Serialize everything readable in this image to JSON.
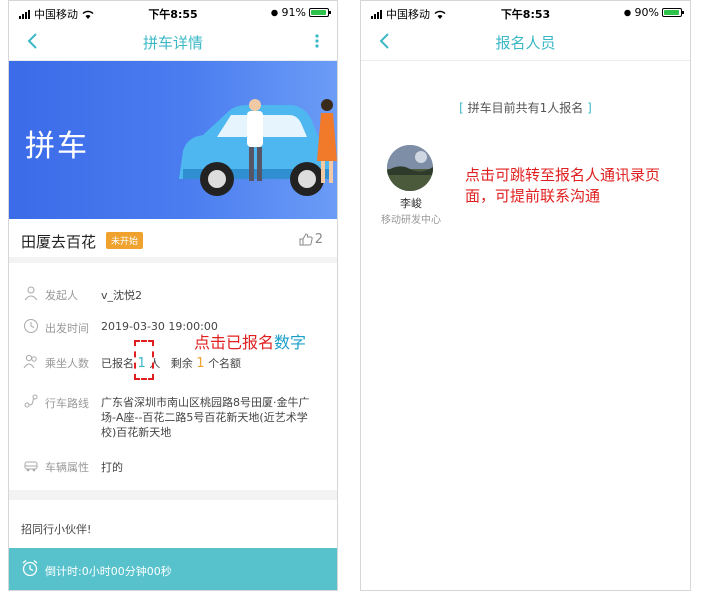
{
  "left": {
    "status": {
      "carrier": "中国移动",
      "time": "下午8:55",
      "battery": "91%"
    },
    "nav": {
      "title": "拼车详情"
    },
    "banner": {
      "text": "拼车"
    },
    "trip": {
      "title": "田厦去百花",
      "status_badge": "未开始",
      "likes": "2"
    },
    "info": {
      "initiator_label": "发起人",
      "initiator_value": "v_沈悦2",
      "depart_label": "出发时间",
      "depart_value": "2019-03-30 19:00:00",
      "passengers_label": "乘坐人数",
      "signed_prefix": "已报名",
      "signed_count": "1",
      "signed_unit": "人",
      "remaining_prefix": "剩余",
      "remaining_count": "1",
      "remaining_suffix": "个名额",
      "route_label": "行车路线",
      "route_value": "广东省深圳市南山区桃园路8号田厦·金牛广场-A座--百花二路5号百花新天地(近艺术学校)百花新天地",
      "vehicle_label": "车辆属性",
      "vehicle_value": "打的"
    },
    "invite": "招同行小伙伴!",
    "countdown": "倒计时:0小时00分钟00秒",
    "annotation": {
      "main": "点击已报名",
      "highlight": "数字"
    }
  },
  "right": {
    "status": {
      "carrier": "中国移动",
      "time": "下午8:53",
      "battery": "90%"
    },
    "nav": {
      "title": "报名人员"
    },
    "count_text": "拼车目前共有1人报名",
    "count_bracket_open": "[",
    "count_bracket_close": "]",
    "person": {
      "name": "李峻",
      "dept": "移动研发中心"
    },
    "annotation": "点击可跳转至报名人通讯录页面，可提前联系沟通"
  },
  "colors": {
    "accent": "#3bb8c6",
    "badge": "#f0a22e",
    "annotation": "#e02020",
    "banner": "#4b7df0"
  },
  "icons": [
    "signal-icon",
    "wifi-icon",
    "alarm-icon",
    "battery-icon",
    "back-chevron-icon",
    "more-dots-icon",
    "thumbs-up-icon",
    "person-icon",
    "clock-icon",
    "group-icon",
    "route-icon",
    "car-icon",
    "alarm-clock-icon"
  ]
}
